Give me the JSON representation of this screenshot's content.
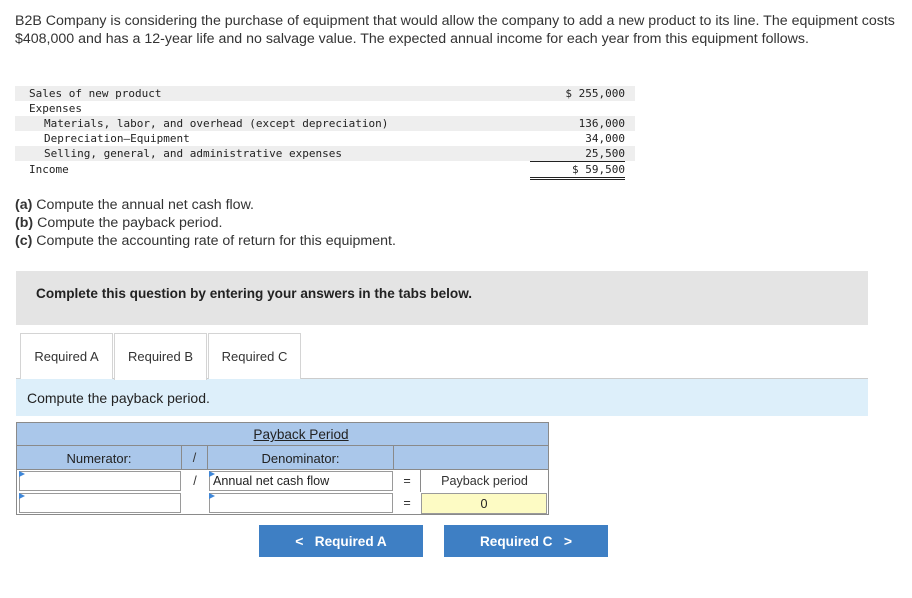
{
  "intro": "B2B Company is considering the purchase of equipment that would allow the company to add a new product to its line. The equipment costs $408,000 and has a 12-year life and no salvage value. The expected annual income for each year from this equipment follows.",
  "income_table": {
    "rows": [
      {
        "label": "Sales of new product",
        "value": "$ 255,000"
      },
      {
        "label": "Expenses",
        "value": ""
      },
      {
        "label": "Materials, labor, and overhead (except depreciation)",
        "value": "136,000"
      },
      {
        "label": "Depreciation—Equipment",
        "value": "34,000"
      },
      {
        "label": "Selling, general, and administrative expenses",
        "value": "25,500"
      },
      {
        "label": "Income",
        "value": "$ 59,500"
      }
    ]
  },
  "requirements": [
    {
      "letter": "(a)",
      "text": " Compute the annual net cash flow."
    },
    {
      "letter": "(b)",
      "text": " Compute the payback period."
    },
    {
      "letter": "(c)",
      "text": " Compute the accounting rate of return for this equipment."
    }
  ],
  "banner": "Complete this question by entering your answers in the tabs below.",
  "tabs": [
    {
      "label": "Required A"
    },
    {
      "label": "Required B"
    },
    {
      "label": "Required C"
    }
  ],
  "prompt": "Compute the payback period.",
  "payback": {
    "title": "Payback Period",
    "numerator_label": "Numerator:",
    "denominator_label": "Denominator:",
    "divide": "/",
    "equals": "=",
    "row1": {
      "numerator": "",
      "denominator": "Annual net cash flow",
      "result": "Payback period"
    },
    "row2": {
      "numerator": "",
      "denominator": "",
      "result": "0"
    }
  },
  "nav": {
    "prev": {
      "chevron": "<",
      "label": "Required A"
    },
    "next": {
      "chevron": ">",
      "label": "Required C"
    }
  },
  "colors": {
    "button": "#3e7fc4",
    "header": "#aac7ea",
    "prompt_bg": "#ddeffa",
    "result_bg": "#fdfbc4",
    "banner_bg": "#e4e4e4"
  }
}
